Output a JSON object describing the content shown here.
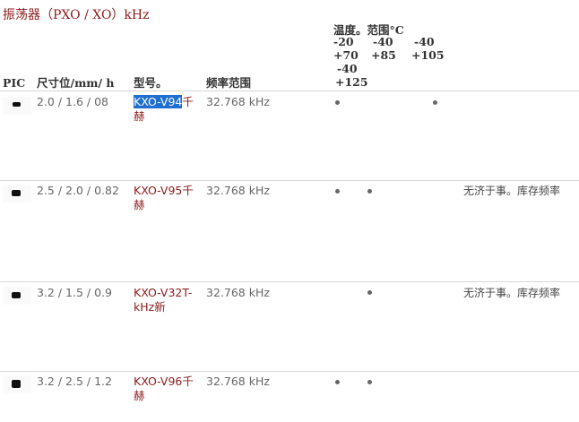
{
  "title": "振荡器（PXO / XO）kHz",
  "headers": {
    "pic": "PIC",
    "size": "尺寸位/mm/ h",
    "model": "型号。",
    "freq": "频率范围",
    "temp_title": "温度。范围°C",
    "temp_cols": [
      {
        "line1": "-20",
        "line2": "+70"
      },
      {
        "line1": "-40",
        "line2": "+85"
      },
      {
        "line1": "-40",
        "line2": "+105"
      },
      {
        "line1": "-40",
        "line2": "+125"
      }
    ]
  },
  "rows": [
    {
      "size": "2.0 / 1.6 / 08",
      "model_selected": "KXO-V94",
      "model_rest": "千赫",
      "freq": "32.768 kHz",
      "temps": [
        true,
        false,
        true,
        false
      ],
      "note": ""
    },
    {
      "size": "2.5 / 2.0 / 0.82",
      "model_selected": "",
      "model_rest": "KXO-V95千赫",
      "freq": "32.768 kHz",
      "temps": [
        true,
        true,
        false,
        false
      ],
      "note": "无济于事。库存频率"
    },
    {
      "size": "3.2 / 1.5 / 0.9",
      "model_selected": "",
      "model_rest": "KXO-V32T-kHz新",
      "freq": "32.768 kHz",
      "temps": [
        false,
        true,
        false,
        false
      ],
      "note": "无济于事。库存频率"
    },
    {
      "size": "3.2 / 2.5 / 1.2",
      "model_selected": "",
      "model_rest": "KXO-V96千赫",
      "freq": "32.768 kHz",
      "temps": [
        true,
        true,
        false,
        false
      ],
      "note": ""
    }
  ]
}
